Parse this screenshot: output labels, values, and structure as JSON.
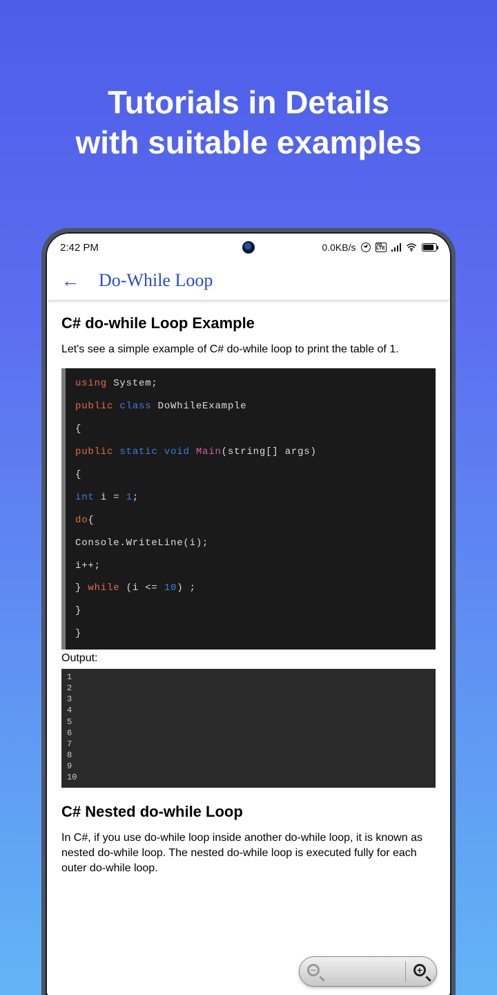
{
  "promo": {
    "line1": "Tutorials in Details",
    "line2": "with suitable examples"
  },
  "statusbar": {
    "time": "2:42 PM",
    "net_speed": "0.0KB/s",
    "volte_badge": "Vo\nLTE"
  },
  "appbar": {
    "back_glyph": "←",
    "title": "Do-While Loop"
  },
  "article": {
    "h1": "C# do-while Loop Example",
    "p1": "Let's see a simple example of C# do-while loop to print the table of 1.",
    "output_label": "Output:",
    "h2": "C# Nested do-while Loop",
    "p2": "In C#, if you use do-while loop inside another do-while loop, it is known as nested do-while loop. The nested do-while loop is executed fully for each outer do-while loop."
  },
  "code": {
    "lines": [
      [
        {
          "t": "using",
          "c": "kw-using"
        },
        {
          "t": " System;",
          "c": ""
        }
      ],
      [],
      [
        {
          "t": "public",
          "c": "kw-using"
        },
        {
          "t": " ",
          "c": ""
        },
        {
          "t": "class",
          "c": "kw-blue"
        },
        {
          "t": " DoWhileExample",
          "c": ""
        }
      ],
      [],
      [
        {
          "t": "{",
          "c": ""
        }
      ],
      [],
      [
        {
          "t": "public",
          "c": "kw-using"
        },
        {
          "t": " ",
          "c": ""
        },
        {
          "t": "static",
          "c": "kw-blue"
        },
        {
          "t": " ",
          "c": ""
        },
        {
          "t": "void",
          "c": "kw-blue"
        },
        {
          "t": " ",
          "c": ""
        },
        {
          "t": "Main",
          "c": "kw-magenta"
        },
        {
          "t": "(",
          "c": ""
        },
        {
          "t": "string",
          "c": ""
        },
        {
          "t": "[] args)",
          "c": ""
        }
      ],
      [],
      [
        {
          "t": "{",
          "c": ""
        }
      ],
      [],
      [
        {
          "t": "int",
          "c": "kw-blue"
        },
        {
          "t": " i = ",
          "c": ""
        },
        {
          "t": "1",
          "c": "kw-num"
        },
        {
          "t": ";",
          "c": ""
        }
      ],
      [],
      [
        {
          "t": "do",
          "c": "kw-using"
        },
        {
          "t": "{",
          "c": ""
        }
      ],
      [],
      [
        {
          "t": "Console.WriteLine(i);",
          "c": ""
        }
      ],
      [],
      [
        {
          "t": "i++;",
          "c": ""
        }
      ],
      [],
      [
        {
          "t": "} ",
          "c": ""
        },
        {
          "t": "while",
          "c": "kw-using"
        },
        {
          "t": " (i <= ",
          "c": ""
        },
        {
          "t": "10",
          "c": "kw-num"
        },
        {
          "t": ") ;",
          "c": ""
        }
      ],
      [],
      [
        {
          "t": "}",
          "c": ""
        }
      ],
      [],
      [
        {
          "t": "}",
          "c": ""
        }
      ]
    ]
  },
  "output_lines": [
    "1",
    "2",
    "3",
    "4",
    "5",
    "6",
    "7",
    "8",
    "9",
    "10"
  ],
  "zoom": {
    "out": "−",
    "in": "+"
  }
}
